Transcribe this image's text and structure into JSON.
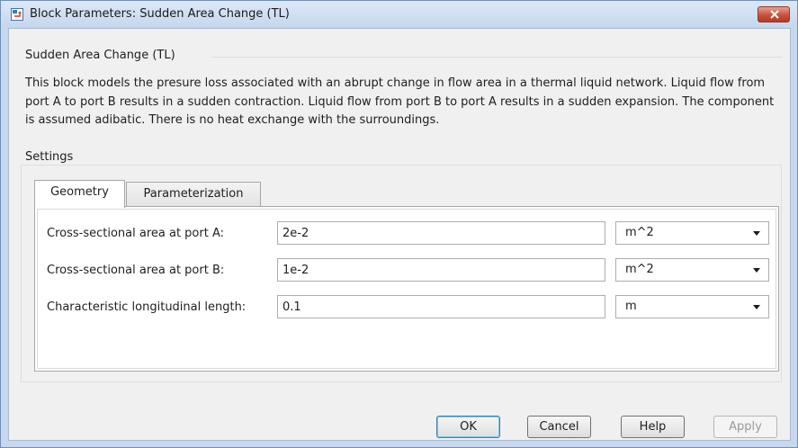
{
  "window": {
    "title": "Block Parameters: Sudden Area Change (TL)",
    "close_icon": "close-icon"
  },
  "block_group": {
    "label": "Sudden Area Change (TL)",
    "description": "This block models the presure loss associated with an abrupt change in flow area in a thermal liquid network. Liquid flow from port A to port B results in a sudden contraction. Liquid flow from port B to port A results in a sudden expansion. The component is assumed adibatic. There is no heat exchange with the surroundings."
  },
  "settings": {
    "label": "Settings",
    "tabs": [
      {
        "label": "Geometry",
        "active": true
      },
      {
        "label": "Parameterization",
        "active": false
      }
    ],
    "params": [
      {
        "label": "Cross-sectional area at port A:",
        "value": "2e-2",
        "unit": "m^2"
      },
      {
        "label": "Cross-sectional area at port B:",
        "value": "1e-2",
        "unit": "m^2"
      },
      {
        "label": "Characteristic longitudinal length:",
        "value": "0.1",
        "unit": "m"
      }
    ]
  },
  "buttons": {
    "ok": "OK",
    "cancel": "Cancel",
    "help": "Help",
    "apply": "Apply"
  },
  "colors": {
    "close_button": "#c9513d",
    "window_frame": "#c7d8ee"
  }
}
